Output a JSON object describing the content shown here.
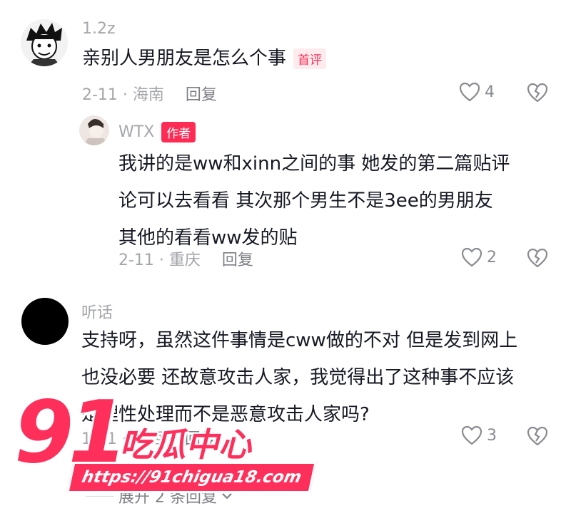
{
  "colors": {
    "accent": "#fe2c55",
    "meta": "#a5a6ab",
    "text": "#161823",
    "logo": "#ff2f5c"
  },
  "comments": [
    {
      "username": "1.2z",
      "text": "亲别人男朋友是怎么个事",
      "tag": "首评",
      "date_location": "2-11 · 海南",
      "reply_label": "回复",
      "likes": "4",
      "replies": [
        {
          "username": "WTX",
          "tag": "作者",
          "lines": [
            "我讲的是ww和xinn之间的事  她发的第二篇贴评",
            "论可以去看看  其次那个男生不是3ee的男朋友",
            "其他的看看ww发的贴"
          ],
          "date_location": "2-11 · 重庆",
          "reply_label": "回复",
          "likes": "2"
        }
      ]
    },
    {
      "username": "听话",
      "lines": [
        "支持呀，虽然这件事情是cww做的不对 但是发到网上",
        "也没必要 还故意攻击人家，我觉得出了这种事不应该",
        "是理性处理而不是恶意攻击人家吗?"
      ],
      "date_location": "1-11 · 广西",
      "reply_label": "回复",
      "likes": "3",
      "expand_label": "展开 2 条回复"
    }
  ],
  "watermark": {
    "number": "91",
    "title": "吃瓜中心",
    "url": "https://91chigua18.com"
  },
  "icons": {
    "like": "heart-outline-icon",
    "dislike": "broken-heart-icon",
    "expand": "chevron-down-icon"
  }
}
